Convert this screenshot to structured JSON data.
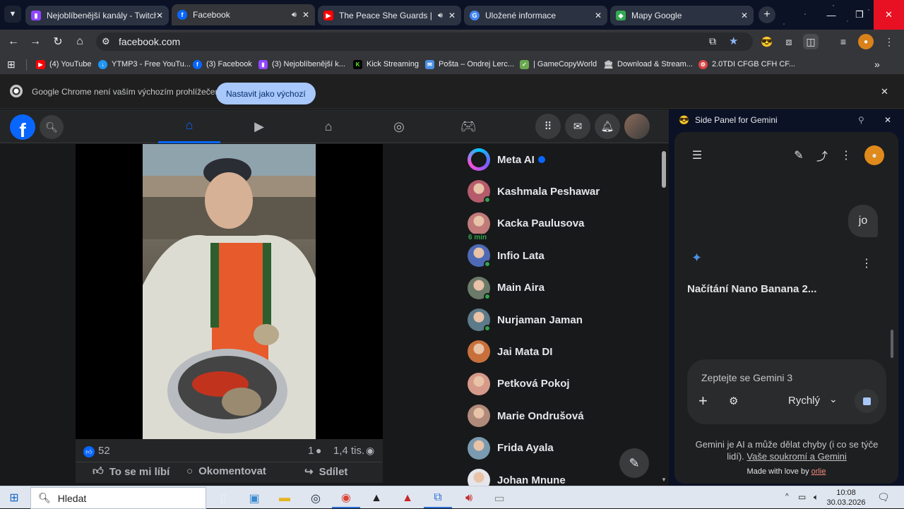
{
  "browser": {
    "tabs": [
      {
        "title": "Nejoblíbenější kanály - Twitch",
        "favicon": "twitch-icon",
        "color": "#9146ff",
        "audio": false,
        "active": false
      },
      {
        "title": "Facebook",
        "favicon": "facebook-icon",
        "color": "#0866ff",
        "audio": true,
        "active": true
      },
      {
        "title": "The Peace She Guards | Am",
        "favicon": "youtube-icon",
        "color": "#ff0000",
        "audio": true,
        "active": false
      },
      {
        "title": "Uložené informace",
        "favicon": "google-icon",
        "color": "#4285f4",
        "audio": false,
        "active": false
      },
      {
        "title": "Mapy Google",
        "favicon": "maps-icon",
        "color": "#34a853",
        "audio": false,
        "active": false
      }
    ],
    "url": "facebook.com",
    "bookmarks": [
      {
        "label": "(4) YouTube",
        "icon": "youtube-icon",
        "color": "#ff0000"
      },
      {
        "label": "YTMP3 - Free YouTu...",
        "icon": "ytmp3-icon",
        "color": "#2196f3"
      },
      {
        "label": "(3) Facebook",
        "icon": "facebook-icon",
        "color": "#0866ff"
      },
      {
        "label": "(3) Nejoblíbenější k...",
        "icon": "twitch-icon",
        "color": "#9146ff"
      },
      {
        "label": "Kick Streaming",
        "icon": "kick-icon",
        "color": "#53fc18"
      },
      {
        "label": "Pošta – Ondrej Lerc...",
        "icon": "mail-icon",
        "color": "#4a90e2"
      },
      {
        "label": "| GameCopyWorld",
        "icon": "gamecopyworld-icon",
        "color": "#6aa84f"
      },
      {
        "label": "Download & Stream...",
        "icon": "library-icon",
        "color": "#cccccc"
      },
      {
        "label": "2.0TDI CFGB CFH CF...",
        "icon": "car-icon",
        "color": "#d44"
      }
    ],
    "infobar": {
      "message": "Google Chrome není vaším výchozím prohlížečem",
      "button": "Nastavit jako výchozí"
    }
  },
  "facebook": {
    "post": {
      "likes": "52",
      "comments": "1",
      "views": "1,4 tis.",
      "like_label": "To se mi líbí",
      "comment_label": "Okomentovat",
      "share_label": "Sdílet"
    },
    "contacts": [
      {
        "name": "Meta AI",
        "verified": true,
        "online": false,
        "color": "#7b5cff"
      },
      {
        "name": "Kashmala Peshawar",
        "online": true,
        "color": "#b55b6b"
      },
      {
        "name": "Kacka Paulusova",
        "online": false,
        "minutes": "6 min",
        "color": "#c07a7a"
      },
      {
        "name": "Infio Lata",
        "online": true,
        "color": "#4e6ab5"
      },
      {
        "name": "Main Aira",
        "online": true,
        "color": "#6c7a6a"
      },
      {
        "name": "Nurjaman Jaman",
        "online": true,
        "color": "#5c7a8a"
      },
      {
        "name": "Jai Mata DI",
        "online": false,
        "color": "#c8703c"
      },
      {
        "name": "Petková Pokoj",
        "online": false,
        "color": "#d69a8a"
      },
      {
        "name": "Marie Ondrušová",
        "online": false,
        "color": "#b08a7a"
      },
      {
        "name": "Frida Ayala",
        "online": false,
        "color": "#7a9ab0"
      },
      {
        "name": "Johan Mnune",
        "online": false,
        "color": "#e4e6eb"
      }
    ]
  },
  "gemini": {
    "panel_title": "Side Panel for Gemini",
    "user_message": "jo",
    "loading_text": "Načítání Nano Banana 2...",
    "input_placeholder": "Zeptejte se Gemini 3",
    "mode": "Rychlý",
    "disclaimer": "Gemini je AI a může dělat chyby (i co se týče lidí).",
    "privacy_link": "Vaše soukromí a Gemini",
    "made_prefix": "Made with love by",
    "made_author": "orlie"
  },
  "taskbar": {
    "search_placeholder": "Hledat",
    "time": "10:08",
    "date": "30.03.2026"
  }
}
